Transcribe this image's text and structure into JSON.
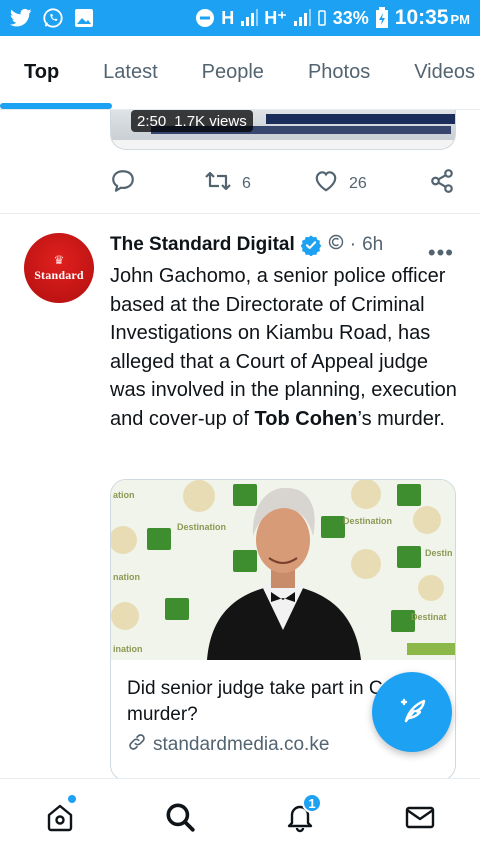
{
  "status_bar": {
    "left_icons": [
      "twitter-icon",
      "whatsapp-icon",
      "gallery-icon"
    ],
    "network_label_1": "H",
    "network_label_2": "H⁺",
    "battery": "33%",
    "time": "10:35",
    "ampm": "PM"
  },
  "tabs": [
    {
      "label": "Top",
      "active": true
    },
    {
      "label": "Latest",
      "active": false
    },
    {
      "label": "People",
      "active": false
    },
    {
      "label": "Photos",
      "active": false
    },
    {
      "label": "Videos",
      "active": false
    }
  ],
  "previous_tweet": {
    "video_time": "2:50",
    "video_views": "1.7K views",
    "retweets": "6",
    "likes": "26"
  },
  "tweet": {
    "author": "The Standard Digital",
    "time": "6h",
    "avatar_text": "Standard",
    "body_text_1": "John Gachomo, a senior police officer based at the Directorate of Criminal Investigations on Kiambu Road, has alleged that a Court of Appeal judge was involved in the planning, execution and cover-up of ",
    "body_bold": "Tob Cohen",
    "body_text_2": "’s murder.",
    "card": {
      "title": "Did senior judge take part in Cohen murder?",
      "domain": "standardmedia.co.ke"
    }
  },
  "bottom_nav": {
    "notifications_count": "1"
  },
  "colors": {
    "accent": "#1da1f2",
    "text_primary": "#0f1419",
    "text_secondary": "#536471",
    "avatar_red": "#c8141a"
  }
}
